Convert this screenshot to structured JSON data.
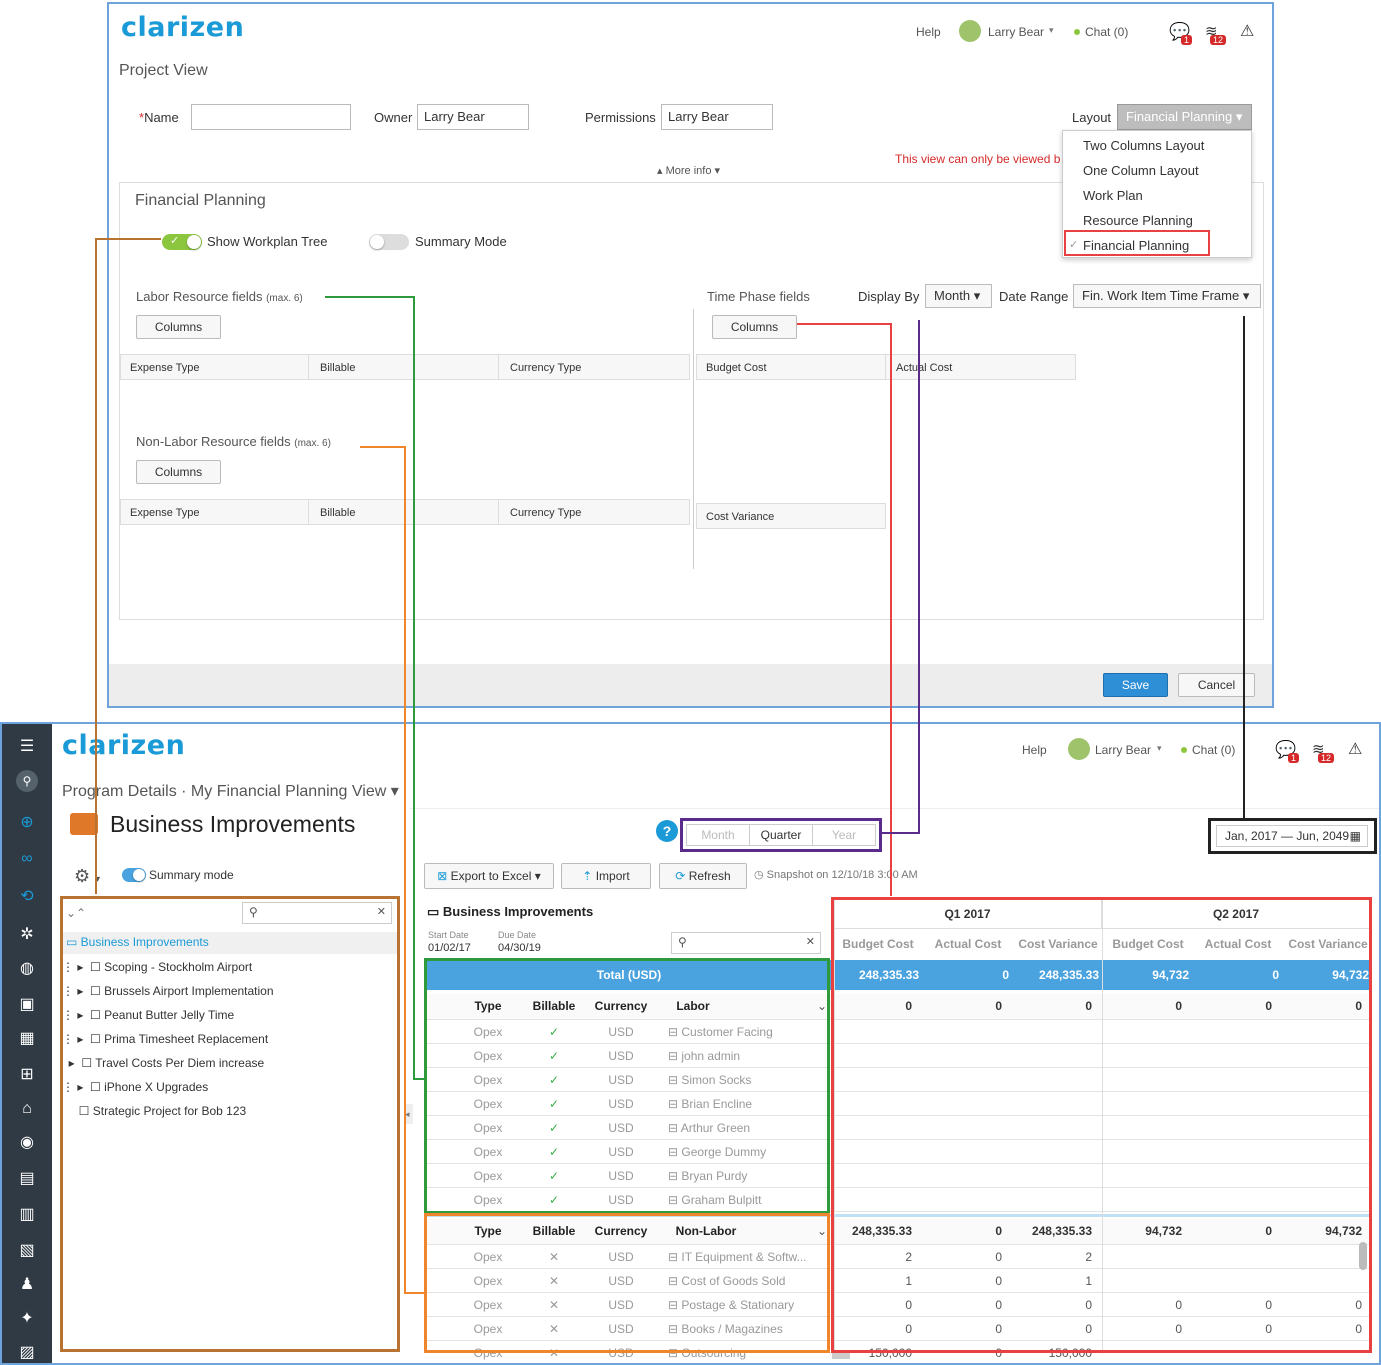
{
  "top_window": {
    "logo": "clarizen",
    "help": "Help",
    "user": "Larry Bear",
    "chat": "Chat (0)",
    "chat_badge": "1",
    "notif_badge": "12",
    "title": "Project View",
    "name_label": "*Name",
    "owner_label": "Owner",
    "owner_value": "Larry Bear",
    "permissions_label": "Permissions",
    "permissions_value": "Larry Bear",
    "layout_label": "Layout",
    "layout_value": "Financial Planning",
    "layout_options": [
      "Two Columns Layout",
      "One Column Layout",
      "Work Plan",
      "Resource Planning",
      "Financial Planning"
    ],
    "warning": "This view can only be viewed b",
    "more_info": "More info",
    "section_title": "Financial Planning",
    "show_tree": "Show Workplan Tree",
    "summary_mode": "Summary Mode",
    "labor_title": "Labor Resource fields",
    "labor_max": "(max. 6)",
    "columns_btn": "Columns",
    "labor_cols": [
      "Expense Type",
      "Billable",
      "Currency Type"
    ],
    "nonlabor_title": "Non-Labor Resource fields",
    "nonlabor_max": "(max. 6)",
    "nonlabor_cols": [
      "Expense Type",
      "Billable",
      "Currency Type"
    ],
    "timephase_title": "Time Phase fields",
    "display_by_label": "Display By",
    "display_by_value": "Month",
    "date_range_label": "Date Range",
    "date_range_value": "Fin. Work Item Time Frame",
    "timephase_cols": [
      "Budget Cost",
      "Actual Cost"
    ],
    "timephase_col3": "Cost Variance",
    "save": "Save",
    "cancel": "Cancel"
  },
  "bottom_window": {
    "logo": "clarizen",
    "help": "Help",
    "user": "Larry Bear",
    "chat": "Chat (0)",
    "chat_badge": "1",
    "notif_badge": "12",
    "breadcrumb1": "Program Details",
    "breadcrumb2": "My Financial Planning View",
    "title": "Business Improvements",
    "summary_mode": "Summary mode",
    "period_tabs": [
      "Month",
      "Quarter",
      "Year"
    ],
    "date_range": "Jan, 2017 — Jun, 2049",
    "export": "Export to Excel",
    "import": "Import",
    "refresh": "Refresh",
    "snapshot": "Snapshot on 12/10/18 3:00 AM",
    "tree_root": "Business Improvements",
    "tree_items": [
      "Scoping - Stockholm Airport",
      "Brussels Airport Implementation",
      "Peanut Butter Jelly Time",
      "Prima Timesheet Replacement",
      "Travel Costs Per Diem increase",
      "iPhone X Upgrades",
      "Strategic Project for Bob 123"
    ],
    "grid_title": "Business Improvements",
    "start_label": "Start Date",
    "start_value": "01/02/17",
    "due_label": "Due Date",
    "due_value": "04/30/19",
    "q1": "Q1 2017",
    "q2": "Q2 2017",
    "period_cols": [
      "Budget Cost",
      "Actual Cost",
      "Cost Variance",
      "Budget Cost",
      "Actual Cost",
      "Cost Variance"
    ],
    "total_label": "Total (USD)",
    "total_values": [
      "248,335.33",
      "0",
      "248,335.33",
      "94,732",
      "0",
      "94,732"
    ],
    "labor_header": [
      "Type",
      "Billable",
      "Currency",
      "Labor"
    ],
    "labor_header_values": [
      "0",
      "0",
      "0",
      "0",
      "0",
      "0"
    ],
    "labor_rows": [
      {
        "type": "Opex",
        "billable": "✓",
        "currency": "USD",
        "name": "Customer Facing"
      },
      {
        "type": "Opex",
        "billable": "✓",
        "currency": "USD",
        "name": "john admin"
      },
      {
        "type": "Opex",
        "billable": "✓",
        "currency": "USD",
        "name": "Simon Socks"
      },
      {
        "type": "Opex",
        "billable": "✓",
        "currency": "USD",
        "name": "Brian Encline"
      },
      {
        "type": "Opex",
        "billable": "✓",
        "currency": "USD",
        "name": "Arthur Green"
      },
      {
        "type": "Opex",
        "billable": "✓",
        "currency": "USD",
        "name": "George Dummy"
      },
      {
        "type": "Opex",
        "billable": "✓",
        "currency": "USD",
        "name": "Bryan Purdy"
      },
      {
        "type": "Opex",
        "billable": "✓",
        "currency": "USD",
        "name": "Graham Bulpitt"
      }
    ],
    "nonlabor_header": [
      "Type",
      "Billable",
      "Currency",
      "Non-Labor"
    ],
    "nonlabor_header_values": [
      "248,335.33",
      "0",
      "248,335.33",
      "94,732",
      "0",
      "94,732"
    ],
    "nonlabor_rows": [
      {
        "type": "Opex",
        "billable": "✕",
        "currency": "USD",
        "name": "IT Equipment & Softw...",
        "values": [
          "2",
          "0",
          "2",
          "",
          "",
          ""
        ]
      },
      {
        "type": "Opex",
        "billable": "✕",
        "currency": "USD",
        "name": "Cost of Goods Sold",
        "values": [
          "1",
          "0",
          "1",
          "",
          "",
          ""
        ]
      },
      {
        "type": "Opex",
        "billable": "✕",
        "currency": "USD",
        "name": "Postage & Stationary",
        "values": [
          "0",
          "0",
          "0",
          "0",
          "0",
          "0"
        ]
      },
      {
        "type": "Opex",
        "billable": "✕",
        "currency": "USD",
        "name": "Books / Magazines",
        "values": [
          "0",
          "0",
          "0",
          "0",
          "0",
          "0"
        ]
      },
      {
        "type": "Opex",
        "billable": "✕",
        "currency": "USD",
        "name": "Outsourcing",
        "values": [
          "150,000",
          "0",
          "150,000",
          "",
          "",
          ""
        ]
      }
    ]
  },
  "colors": {
    "brand": "#1a9ad6",
    "accent_total": "#4aa3df",
    "sidebar": "#2f3a44",
    "anno_brown": "#b87333",
    "anno_green": "#2e9a3c",
    "anno_orange": "#f0862b",
    "anno_red": "#e8413f",
    "anno_purple": "#5b2b8c",
    "anno_black": "#222222"
  }
}
